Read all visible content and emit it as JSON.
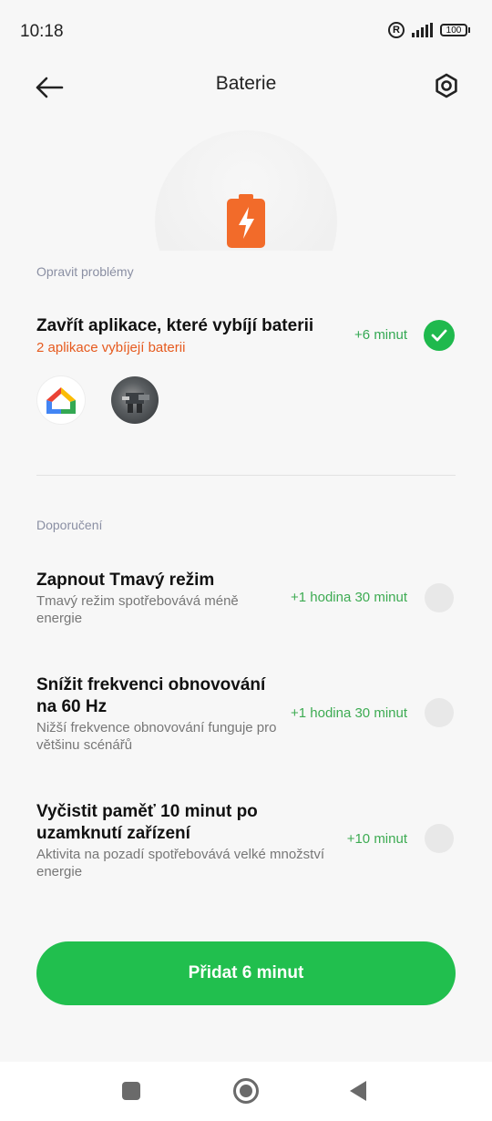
{
  "status": {
    "time": "10:18",
    "battery": "100"
  },
  "header": {
    "title": "Baterie"
  },
  "fix_section": {
    "label": "Opravit problémy",
    "item": {
      "title": "Zavřít aplikace, které vybíjí baterii",
      "subtitle": "2 aplikace vybíjejí baterii",
      "gain": "+6 minut",
      "checked": true
    },
    "apps": [
      "google-home-icon",
      "game-app-icon"
    ]
  },
  "recommend_section": {
    "label": "Doporučení",
    "items": [
      {
        "title": "Zapnout Tmavý režim",
        "subtitle_line1": "Tmavý režim spotřebovává méně",
        "subtitle_line2": "energie",
        "gain": "+1 hodina 30 minut",
        "checked": false
      },
      {
        "title_line1": "Snížit frekvenci obnovování",
        "title_line2": "na 60 Hz",
        "subtitle_line1": "Nižší frekvence obnovování funguje pro",
        "subtitle_line2": "většinu scénářů",
        "gain": "+1 hodina 30 minut",
        "checked": false
      },
      {
        "title_line1": "Vyčistit paměť 10 minut po",
        "title_line2": "uzamknutí zařízení",
        "subtitle_line1": "Aktivita na pozadí spotřebovává velké množství",
        "subtitle_line2": "energie",
        "gain": "+10 minut",
        "checked": false
      }
    ]
  },
  "cta": {
    "label": "Přidat 6 minut"
  },
  "colors": {
    "accent_green": "#21bf4e",
    "warning_orange": "#e65a1e",
    "gain_green": "#34a853"
  }
}
